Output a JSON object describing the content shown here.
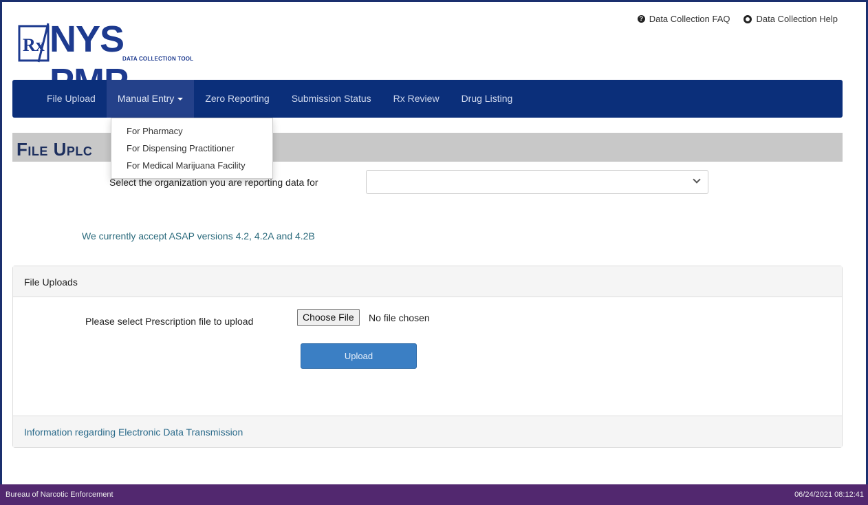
{
  "logo": {
    "rx": "Rx",
    "name": "NYS PMP",
    "subtitle": "DATA COLLECTION TOOL"
  },
  "top_links": {
    "faq": "Data Collection FAQ",
    "help": "Data Collection Help"
  },
  "nav": {
    "items": [
      {
        "label": "File Upload"
      },
      {
        "label": "Manual Entry"
      },
      {
        "label": "Zero Reporting"
      },
      {
        "label": "Submission Status"
      },
      {
        "label": "Rx Review"
      },
      {
        "label": "Drug Listing"
      }
    ]
  },
  "dropdown": {
    "items": [
      {
        "label": "For Pharmacy"
      },
      {
        "label": "For Dispensing Practitioner"
      },
      {
        "label": "For Medical Marijuana Facility"
      }
    ]
  },
  "page": {
    "title": "File Uplc",
    "org_label": "Select the organization you are reporting data for",
    "org_value": "",
    "asap_note": "We currently accept ASAP versions 4.2, 4.2A and 4.2B"
  },
  "panel": {
    "heading": "File Uploads",
    "file_label": "Please select Prescription file to upload",
    "choose_file": "Choose File",
    "no_file": "No file chosen",
    "upload": "Upload",
    "footer_link": "Information regarding Electronic Data Transmission"
  },
  "footer": {
    "left": "Bureau of Narcotic Enforcement",
    "right": "06/24/2021 08:12:41"
  },
  "colors": {
    "navbar": "#0b2f7a",
    "footer": "#52286f",
    "upload_button": "#3b7fc4"
  }
}
